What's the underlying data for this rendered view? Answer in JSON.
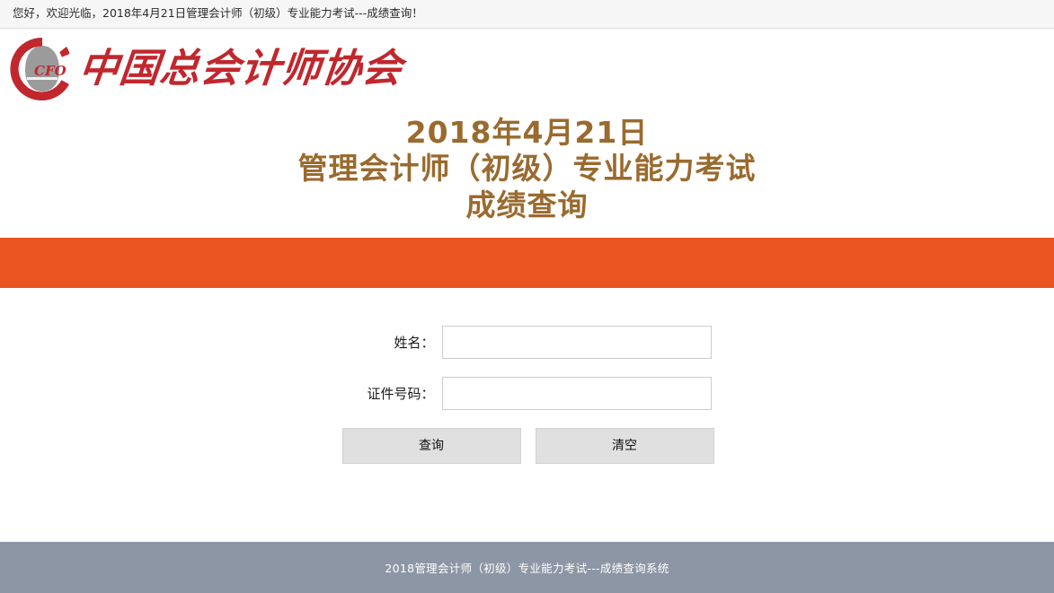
{
  "topbar": {
    "welcome_text": "您好，欢迎光临，2018年4月21日管理会计师（初级）专业能力考试---成绩查询！"
  },
  "brand": {
    "logo_icon": "cfo-ring-logo",
    "logo_inner_text": "CFO",
    "organization_name": "中国总会计师协会",
    "logo_red": "#c1272d",
    "logo_gray": "#9b9b9b"
  },
  "title": {
    "line1": "2018年4月21日",
    "line2": "管理会计师（初级）专业能力考试",
    "line3": "成绩查询",
    "color": "#9a6a2e"
  },
  "band": {
    "color": "#ea5420"
  },
  "form": {
    "fields": [
      {
        "label": "姓名：",
        "value": "",
        "placeholder": "",
        "name": "name-field"
      },
      {
        "label": "证件号码：",
        "value": "",
        "placeholder": "",
        "name": "id-number-field"
      }
    ],
    "buttons": [
      {
        "label": "查询",
        "name": "query-button"
      },
      {
        "label": "清空",
        "name": "clear-button"
      }
    ]
  },
  "footer": {
    "text": "2018管理会计师（初级）专业能力考试---成绩查询系统",
    "background": "#8d96a5"
  }
}
